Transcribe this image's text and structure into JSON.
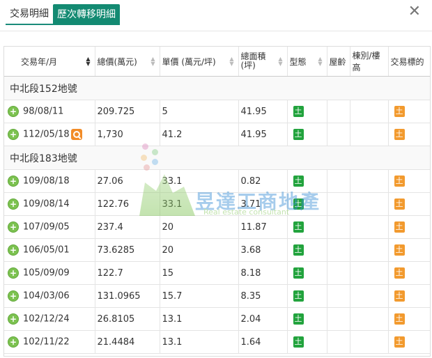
{
  "tabs": [
    {
      "label": "交易明細",
      "active": false
    },
    {
      "label": "歷次轉移明細",
      "active": true
    }
  ],
  "close_icon": "close-icon",
  "columns": [
    "交易年/月",
    "總價(萬元)",
    "單價 (萬元/坪)",
    "總面積\n(坪)",
    "型態",
    "屋齡",
    "棟別/樓高",
    "交易標的"
  ],
  "sorted_column": "交易年/月",
  "groups": [
    {
      "name": "中北段152地號",
      "rows": [
        {
          "date": "98/08/11",
          "total": "209.725",
          "unit": "5",
          "area": "41.95",
          "type": "土",
          "age": "",
          "floor": "",
          "target": "土",
          "has_search": false
        },
        {
          "date": "112/05/18",
          "total": "1,730",
          "unit": "41.2",
          "area": "41.95",
          "type": "土",
          "age": "",
          "floor": "",
          "target": "土",
          "has_search": true
        }
      ]
    },
    {
      "name": "中北段183地號",
      "rows": [
        {
          "date": "109/08/18",
          "total": "27.06",
          "unit": "33.1",
          "area": "0.82",
          "type": "土",
          "age": "",
          "floor": "",
          "target": "土",
          "has_search": false
        },
        {
          "date": "109/08/14",
          "total": "122.76",
          "unit": "33.1",
          "area": "3.71",
          "type": "土",
          "age": "",
          "floor": "",
          "target": "土",
          "has_search": false
        },
        {
          "date": "107/09/05",
          "total": "237.4",
          "unit": "20",
          "area": "11.87",
          "type": "土",
          "age": "",
          "floor": "",
          "target": "土",
          "has_search": false
        },
        {
          "date": "106/05/01",
          "total": "73.6285",
          "unit": "20",
          "area": "3.68",
          "type": "土",
          "age": "",
          "floor": "",
          "target": "土",
          "has_search": false
        },
        {
          "date": "105/09/09",
          "total": "122.7",
          "unit": "15",
          "area": "8.18",
          "type": "土",
          "age": "",
          "floor": "",
          "target": "土",
          "has_search": false
        },
        {
          "date": "104/03/06",
          "total": "131.0965",
          "unit": "15.7",
          "area": "8.35",
          "type": "土",
          "age": "",
          "floor": "",
          "target": "土",
          "has_search": false
        },
        {
          "date": "102/12/24",
          "total": "26.8105",
          "unit": "13.1",
          "area": "2.04",
          "type": "土",
          "age": "",
          "floor": "",
          "target": "土",
          "has_search": false
        },
        {
          "date": "102/11/22",
          "total": "21.4484",
          "unit": "13.1",
          "area": "1.64",
          "type": "土",
          "age": "",
          "floor": "",
          "target": "土",
          "has_search": false
        }
      ]
    }
  ],
  "watermark": {
    "cn": "昱達工商地產",
    "en": "Real estate consultant"
  },
  "colors": {
    "accent": "#138a72",
    "type_badge": "#22a33d",
    "target_badge": "#f29a2e",
    "plus": "#7cc250"
  }
}
